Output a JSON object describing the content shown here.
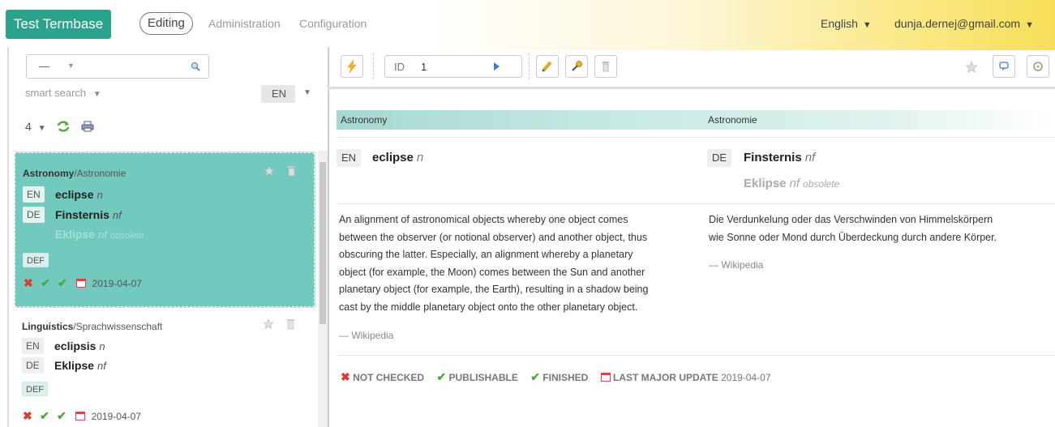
{
  "topbar": {
    "brand": "Test Termbase",
    "nav": [
      "Editing",
      "Administration",
      "Configuration"
    ],
    "language": "English",
    "user": "dunja.dernej@gmail.com"
  },
  "left": {
    "search_value": "—",
    "smart_search": "smart search",
    "lang": "EN",
    "count": "4",
    "entries": [
      {
        "domain": "Astronomy",
        "domain_translation": "/Astronomie",
        "en_tag": "EN",
        "en_term": "eclipse",
        "en_pos": "n",
        "de_tag": "DE",
        "de_term": "Finsternis",
        "de_pos": "nf",
        "de_term2": "Eklipse",
        "de_pos2": "nf",
        "de_note2": "obsolete",
        "def_tag": "DEF",
        "date": "2019-04-07"
      },
      {
        "domain": "Linguistics",
        "domain_translation": "/Sprachwissenschaft",
        "en_tag": "EN",
        "en_term": "eclipsis",
        "en_pos": "n",
        "de_tag": "DE",
        "de_term": "Eklipse",
        "de_pos": "nf",
        "def_tag": "DEF",
        "date": "2019-04-07"
      }
    ]
  },
  "right": {
    "id_label": "ID",
    "id_value": "1",
    "col_en_domain": "Astronomy",
    "col_de_domain": "Astronomie",
    "en_tag": "EN",
    "en_term": "eclipse",
    "en_pos": "n",
    "de_tag": "DE",
    "de_term": "Finsternis",
    "de_pos": "nf",
    "de_term2": "Eklipse",
    "de_pos2": "nf",
    "de_note2": "obsolete",
    "en_def_lines": [
      "An alignment of astronomical objects whereby one object comes",
      "between the observer (or notional observer) and another object, thus",
      "obscuring the latter. Especially, an alignment whereby a planetary",
      "object (for example, the Moon) comes between the Sun and another",
      "planetary object (for example, the Earth), resulting in a shadow being",
      "cast by the middle planetary object onto the other planetary object."
    ],
    "en_source": "— Wikipedia",
    "de_def_lines": [
      "Die Verdunkelung oder das Verschwinden von Himmelskörpern",
      "wie Sonne oder Mond durch Überdeckung durch andere Körper."
    ],
    "de_source": "— Wikipedia",
    "status": {
      "not_checked": "NOT CHECKED",
      "publishable": "PUBLISHABLE",
      "finished": "FINISHED",
      "last_update_label": "LAST MAJOR UPDATE",
      "last_update_date": "2019-04-07"
    }
  },
  "colors": {
    "brand": "#2aa28c",
    "selected_entry": "#72c9bd",
    "reject": "#e03b2b",
    "accept": "#4ba83a"
  }
}
